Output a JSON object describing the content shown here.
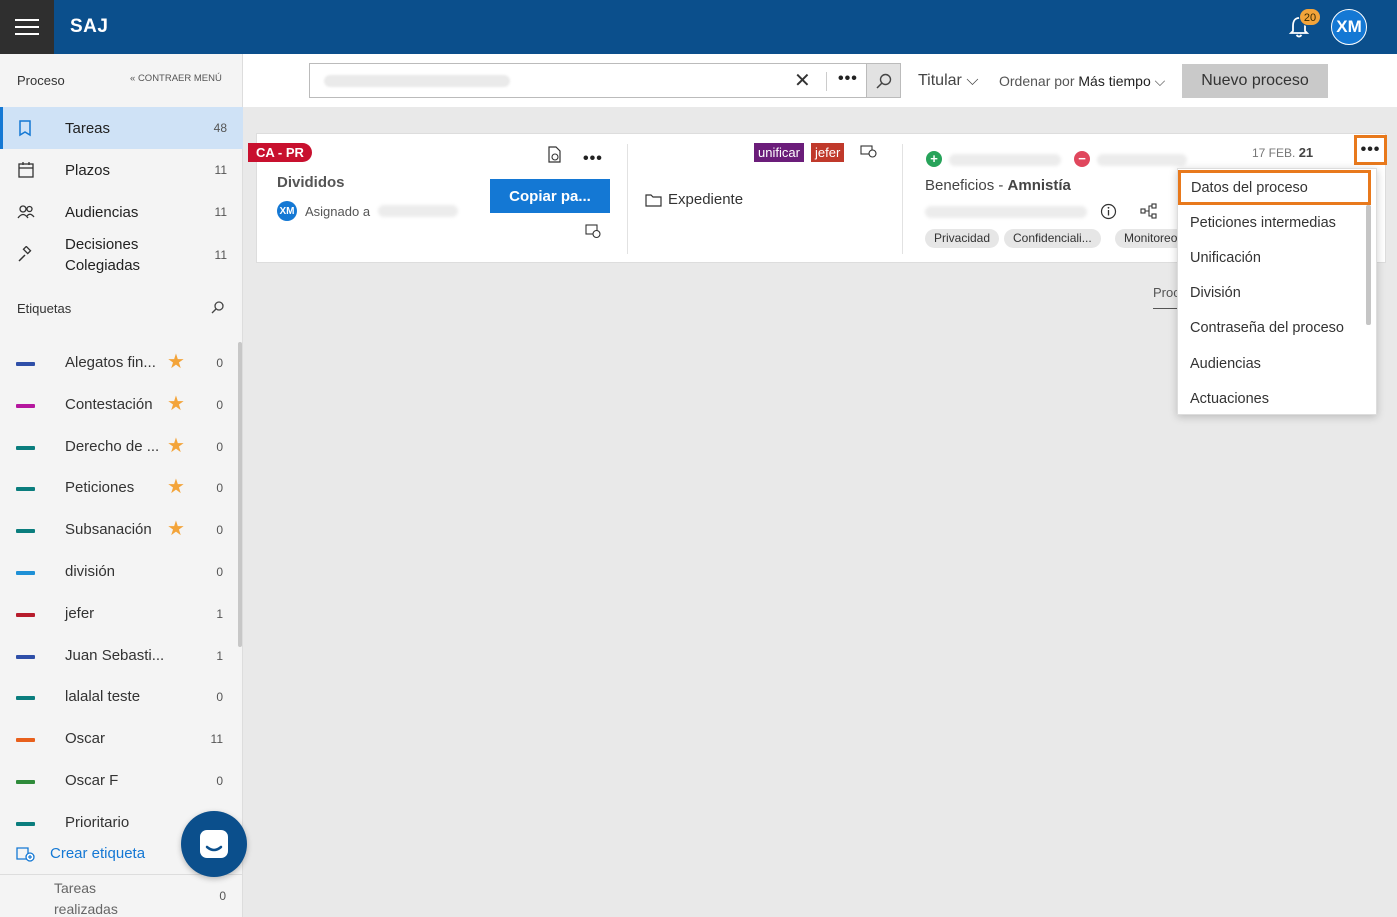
{
  "header": {
    "brand": "SAJ",
    "notifications_count": "20",
    "user_initials": "XM"
  },
  "sidebar": {
    "section_title": "Proceso",
    "collapse_label": "CONTRAER MENÚ",
    "nav": [
      {
        "label": "Tareas",
        "count": "48",
        "icon": "book-icon",
        "active": true
      },
      {
        "label": "Plazos",
        "count": "11",
        "icon": "calendar-icon"
      },
      {
        "label": "Audiencias",
        "count": "11",
        "icon": "people-icon"
      },
      {
        "label": "Decisiones Colegiadas",
        "count": "11",
        "icon": "gavel-icon"
      }
    ],
    "tags_title": "Etiquetas",
    "tags": [
      {
        "label": "Alegatos fin...",
        "count": "0",
        "color": "#2f4fa8",
        "star": true
      },
      {
        "label": "Contestación",
        "count": "0",
        "color": "#b5179e",
        "star": true
      },
      {
        "label": "Derecho de ...",
        "count": "0",
        "color": "#0a7d7d",
        "star": true
      },
      {
        "label": "Peticiones",
        "count": "0",
        "color": "#0a7d7d",
        "star": true
      },
      {
        "label": "Subsanación",
        "count": "0",
        "color": "#0a7d7d",
        "star": true
      },
      {
        "label": "división",
        "count": "0",
        "color": "#1e90d6",
        "star": false
      },
      {
        "label": "jefer",
        "count": "1",
        "color": "#b71c2c",
        "star": false
      },
      {
        "label": "Juan Sebasti...",
        "count": "1",
        "color": "#2f4fa8",
        "star": false
      },
      {
        "label": "lalalal teste",
        "count": "0",
        "color": "#0a7d7d",
        "star": false
      },
      {
        "label": "Oscar",
        "count": "11",
        "color": "#e8601c",
        "star": false
      },
      {
        "label": "Oscar F",
        "count": "0",
        "color": "#2e8b3a",
        "star": false
      },
      {
        "label": "Prioritario",
        "count": "",
        "color": "#0a7d7d",
        "star": false
      }
    ],
    "create_tag": "Crear etiqueta",
    "done_tasks": "Tareas realizadas",
    "done_count": "0"
  },
  "toolbar": {
    "search_value": "",
    "filter_label": "Titular",
    "order_prefix": "Ordenar por",
    "order_value": "Más tiempo",
    "new_button": "Nuevo proceso"
  },
  "card": {
    "ribbon": "CA - PR",
    "title": "Divididos",
    "assigned_prefix": "Asignado a",
    "avatar": "XM",
    "copy_button": "Copiar pa...",
    "tag1": "unificar",
    "tag1_color": "#6b1d7a",
    "tag2": "jefer",
    "tag2_color": "#c0392b",
    "folder_label": "Expediente",
    "subject_prefix": "Beneficios - ",
    "subject_bold": "Amnistía",
    "pills": [
      "Privacidad",
      "Confidenciali...",
      "Monitoreo"
    ],
    "date_prefix": "17 FEB.",
    "date_day": "21"
  },
  "tab_peek": "Proc",
  "menu": {
    "items": [
      "Datos del proceso",
      "Peticiones intermedias",
      "Unificación",
      "División",
      "Contraseña del proceso",
      "Audiencias",
      "Actuaciones"
    ]
  }
}
